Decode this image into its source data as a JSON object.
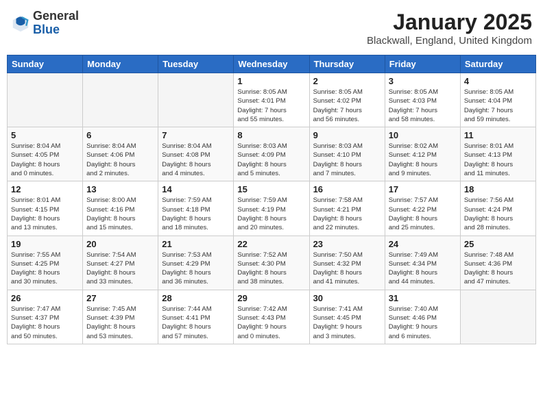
{
  "header": {
    "logo_line1": "General",
    "logo_line2": "Blue",
    "month": "January 2025",
    "location": "Blackwall, England, United Kingdom"
  },
  "weekdays": [
    "Sunday",
    "Monday",
    "Tuesday",
    "Wednesday",
    "Thursday",
    "Friday",
    "Saturday"
  ],
  "weeks": [
    [
      {
        "day": "",
        "info": ""
      },
      {
        "day": "",
        "info": ""
      },
      {
        "day": "",
        "info": ""
      },
      {
        "day": "1",
        "info": "Sunrise: 8:05 AM\nSunset: 4:01 PM\nDaylight: 7 hours\nand 55 minutes."
      },
      {
        "day": "2",
        "info": "Sunrise: 8:05 AM\nSunset: 4:02 PM\nDaylight: 7 hours\nand 56 minutes."
      },
      {
        "day": "3",
        "info": "Sunrise: 8:05 AM\nSunset: 4:03 PM\nDaylight: 7 hours\nand 58 minutes."
      },
      {
        "day": "4",
        "info": "Sunrise: 8:05 AM\nSunset: 4:04 PM\nDaylight: 7 hours\nand 59 minutes."
      }
    ],
    [
      {
        "day": "5",
        "info": "Sunrise: 8:04 AM\nSunset: 4:05 PM\nDaylight: 8 hours\nand 0 minutes."
      },
      {
        "day": "6",
        "info": "Sunrise: 8:04 AM\nSunset: 4:06 PM\nDaylight: 8 hours\nand 2 minutes."
      },
      {
        "day": "7",
        "info": "Sunrise: 8:04 AM\nSunset: 4:08 PM\nDaylight: 8 hours\nand 4 minutes."
      },
      {
        "day": "8",
        "info": "Sunrise: 8:03 AM\nSunset: 4:09 PM\nDaylight: 8 hours\nand 5 minutes."
      },
      {
        "day": "9",
        "info": "Sunrise: 8:03 AM\nSunset: 4:10 PM\nDaylight: 8 hours\nand 7 minutes."
      },
      {
        "day": "10",
        "info": "Sunrise: 8:02 AM\nSunset: 4:12 PM\nDaylight: 8 hours\nand 9 minutes."
      },
      {
        "day": "11",
        "info": "Sunrise: 8:01 AM\nSunset: 4:13 PM\nDaylight: 8 hours\nand 11 minutes."
      }
    ],
    [
      {
        "day": "12",
        "info": "Sunrise: 8:01 AM\nSunset: 4:15 PM\nDaylight: 8 hours\nand 13 minutes."
      },
      {
        "day": "13",
        "info": "Sunrise: 8:00 AM\nSunset: 4:16 PM\nDaylight: 8 hours\nand 15 minutes."
      },
      {
        "day": "14",
        "info": "Sunrise: 7:59 AM\nSunset: 4:18 PM\nDaylight: 8 hours\nand 18 minutes."
      },
      {
        "day": "15",
        "info": "Sunrise: 7:59 AM\nSunset: 4:19 PM\nDaylight: 8 hours\nand 20 minutes."
      },
      {
        "day": "16",
        "info": "Sunrise: 7:58 AM\nSunset: 4:21 PM\nDaylight: 8 hours\nand 22 minutes."
      },
      {
        "day": "17",
        "info": "Sunrise: 7:57 AM\nSunset: 4:22 PM\nDaylight: 8 hours\nand 25 minutes."
      },
      {
        "day": "18",
        "info": "Sunrise: 7:56 AM\nSunset: 4:24 PM\nDaylight: 8 hours\nand 28 minutes."
      }
    ],
    [
      {
        "day": "19",
        "info": "Sunrise: 7:55 AM\nSunset: 4:25 PM\nDaylight: 8 hours\nand 30 minutes."
      },
      {
        "day": "20",
        "info": "Sunrise: 7:54 AM\nSunset: 4:27 PM\nDaylight: 8 hours\nand 33 minutes."
      },
      {
        "day": "21",
        "info": "Sunrise: 7:53 AM\nSunset: 4:29 PM\nDaylight: 8 hours\nand 36 minutes."
      },
      {
        "day": "22",
        "info": "Sunrise: 7:52 AM\nSunset: 4:30 PM\nDaylight: 8 hours\nand 38 minutes."
      },
      {
        "day": "23",
        "info": "Sunrise: 7:50 AM\nSunset: 4:32 PM\nDaylight: 8 hours\nand 41 minutes."
      },
      {
        "day": "24",
        "info": "Sunrise: 7:49 AM\nSunset: 4:34 PM\nDaylight: 8 hours\nand 44 minutes."
      },
      {
        "day": "25",
        "info": "Sunrise: 7:48 AM\nSunset: 4:36 PM\nDaylight: 8 hours\nand 47 minutes."
      }
    ],
    [
      {
        "day": "26",
        "info": "Sunrise: 7:47 AM\nSunset: 4:37 PM\nDaylight: 8 hours\nand 50 minutes."
      },
      {
        "day": "27",
        "info": "Sunrise: 7:45 AM\nSunset: 4:39 PM\nDaylight: 8 hours\nand 53 minutes."
      },
      {
        "day": "28",
        "info": "Sunrise: 7:44 AM\nSunset: 4:41 PM\nDaylight: 8 hours\nand 57 minutes."
      },
      {
        "day": "29",
        "info": "Sunrise: 7:42 AM\nSunset: 4:43 PM\nDaylight: 9 hours\nand 0 minutes."
      },
      {
        "day": "30",
        "info": "Sunrise: 7:41 AM\nSunset: 4:45 PM\nDaylight: 9 hours\nand 3 minutes."
      },
      {
        "day": "31",
        "info": "Sunrise: 7:40 AM\nSunset: 4:46 PM\nDaylight: 9 hours\nand 6 minutes."
      },
      {
        "day": "",
        "info": ""
      }
    ]
  ]
}
